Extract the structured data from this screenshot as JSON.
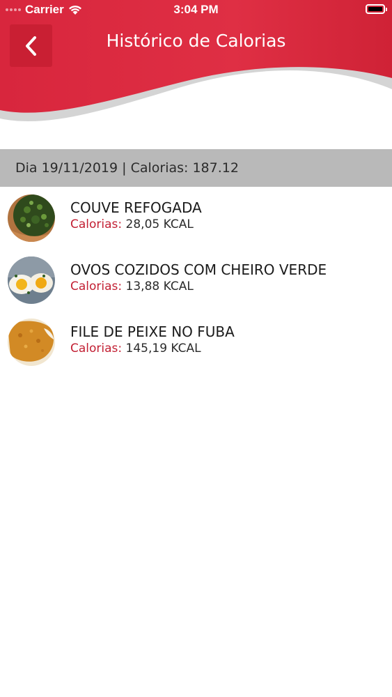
{
  "status_bar": {
    "carrier": "Carrier",
    "time": "3:04 PM"
  },
  "header": {
    "title": "Histórico de Calorias",
    "back_icon": "chevron-left-icon"
  },
  "colors": {
    "header_red": "#d8283e",
    "accent_red": "#c21f33",
    "date_bar_gray": "#b9b9b9"
  },
  "day": {
    "summary": "Dia 19/11/2019 | Calorias: 187.12"
  },
  "foods": [
    {
      "name": "COUVE REFOGADA",
      "calories_label": "Calorias:",
      "calories_value": "28,05 KCAL",
      "image": "sauteed-kale-photo"
    },
    {
      "name": "OVOS COZIDOS COM CHEIRO VERDE",
      "calories_label": "Calorias:",
      "calories_value": "13,88 KCAL",
      "image": "boiled-eggs-photo"
    },
    {
      "name": "FILE DE PEIXE NO FUBA",
      "calories_label": "Calorias:",
      "calories_value": "145,19 KCAL",
      "image": "fried-fish-fillet-photo"
    }
  ]
}
